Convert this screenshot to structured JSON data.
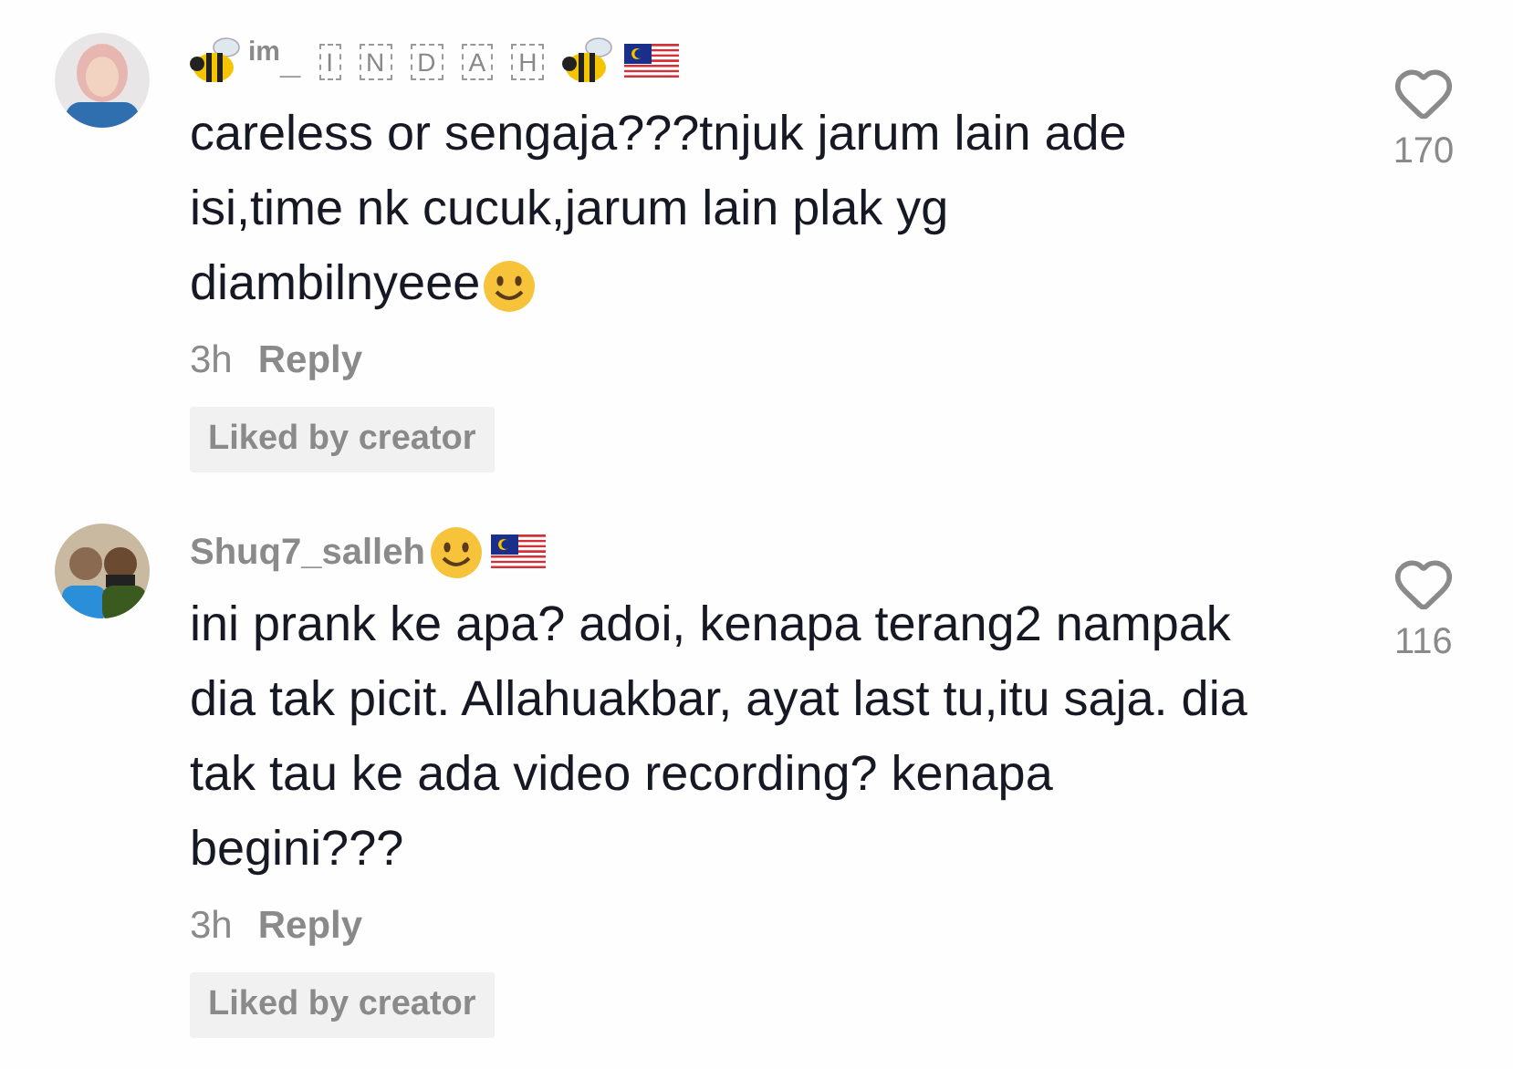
{
  "comments": [
    {
      "username": {
        "kind": "bee",
        "text": "$^{im}$_",
        "boxed_letters": [
          "I",
          "N",
          "D",
          "A",
          "H"
        ]
      },
      "body": "careless or sengaja???tnjuk jarum lain ade isi,time nk cucuk,jarum lain plak yg diambilnyeee",
      "body_emoji": true,
      "time": "3h",
      "reply": "Reply",
      "liked_badge": "Liked by creator",
      "likes": "170"
    },
    {
      "username": {
        "kind": "smiley",
        "text": "Shuq7_salleh"
      },
      "body": "ini prank ke apa? adoi, kenapa terang2 nampak dia tak picit. Allahuakbar, ayat last tu,itu saja. dia tak tau ke ada video recording? kenapa begini???",
      "body_emoji": false,
      "time": "3h",
      "reply": "Reply",
      "liked_badge": "Liked by creator",
      "likes": "116"
    }
  ]
}
